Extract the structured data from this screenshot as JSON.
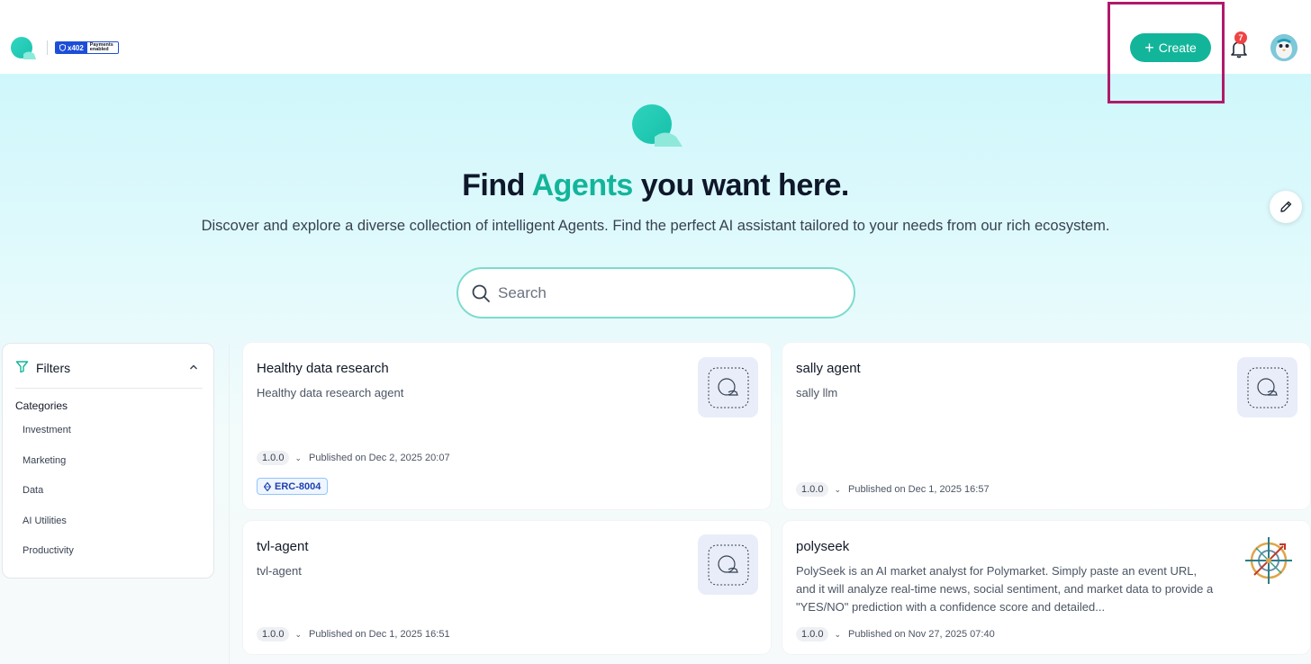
{
  "header": {
    "badge_left": "x402",
    "badge_right": "Payments enabled",
    "create_label": "Create",
    "notifications_count": "7",
    "avatar_label": "Tim"
  },
  "hero": {
    "title_prefix": "Find ",
    "title_accent": "Agents",
    "title_suffix": " you want here.",
    "subtitle": "Discover and explore a diverse collection of intelligent Agents. Find the perfect AI assistant tailored to your needs from our rich ecosystem."
  },
  "search": {
    "placeholder": "Search"
  },
  "filters": {
    "title": "Filters",
    "categories_title": "Categories",
    "categories": [
      "Investment",
      "Marketing",
      "Data",
      "AI Utilities",
      "Productivity"
    ]
  },
  "cards": [
    {
      "name": "Healthy data research",
      "description": "Healthy data research agent",
      "version": "1.0.0",
      "published": "Published on Dec 2, 2025 20:07",
      "tag": "ERC-8004"
    },
    {
      "name": "sally agent",
      "description": "sally llm",
      "version": "1.0.0",
      "published": "Published on Dec 1, 2025 16:57"
    },
    {
      "name": "tvl-agent",
      "description": "tvl-agent",
      "version": "1.0.0",
      "published": "Published on Dec 1, 2025 16:51"
    },
    {
      "name": "polyseek",
      "description": "PolySeek is an AI market analyst for Polymarket. Simply paste an event URL, and it will analyze real-time news, social sentiment, and market data to provide a \"YES/NO\" prediction with a confidence score and detailed...",
      "version": "1.0.0",
      "published": "Published on Nov 27, 2025 07:40"
    }
  ],
  "colors": {
    "brand": "#13b59a",
    "highlight": "#b0196a",
    "badge": "#ef4444"
  }
}
